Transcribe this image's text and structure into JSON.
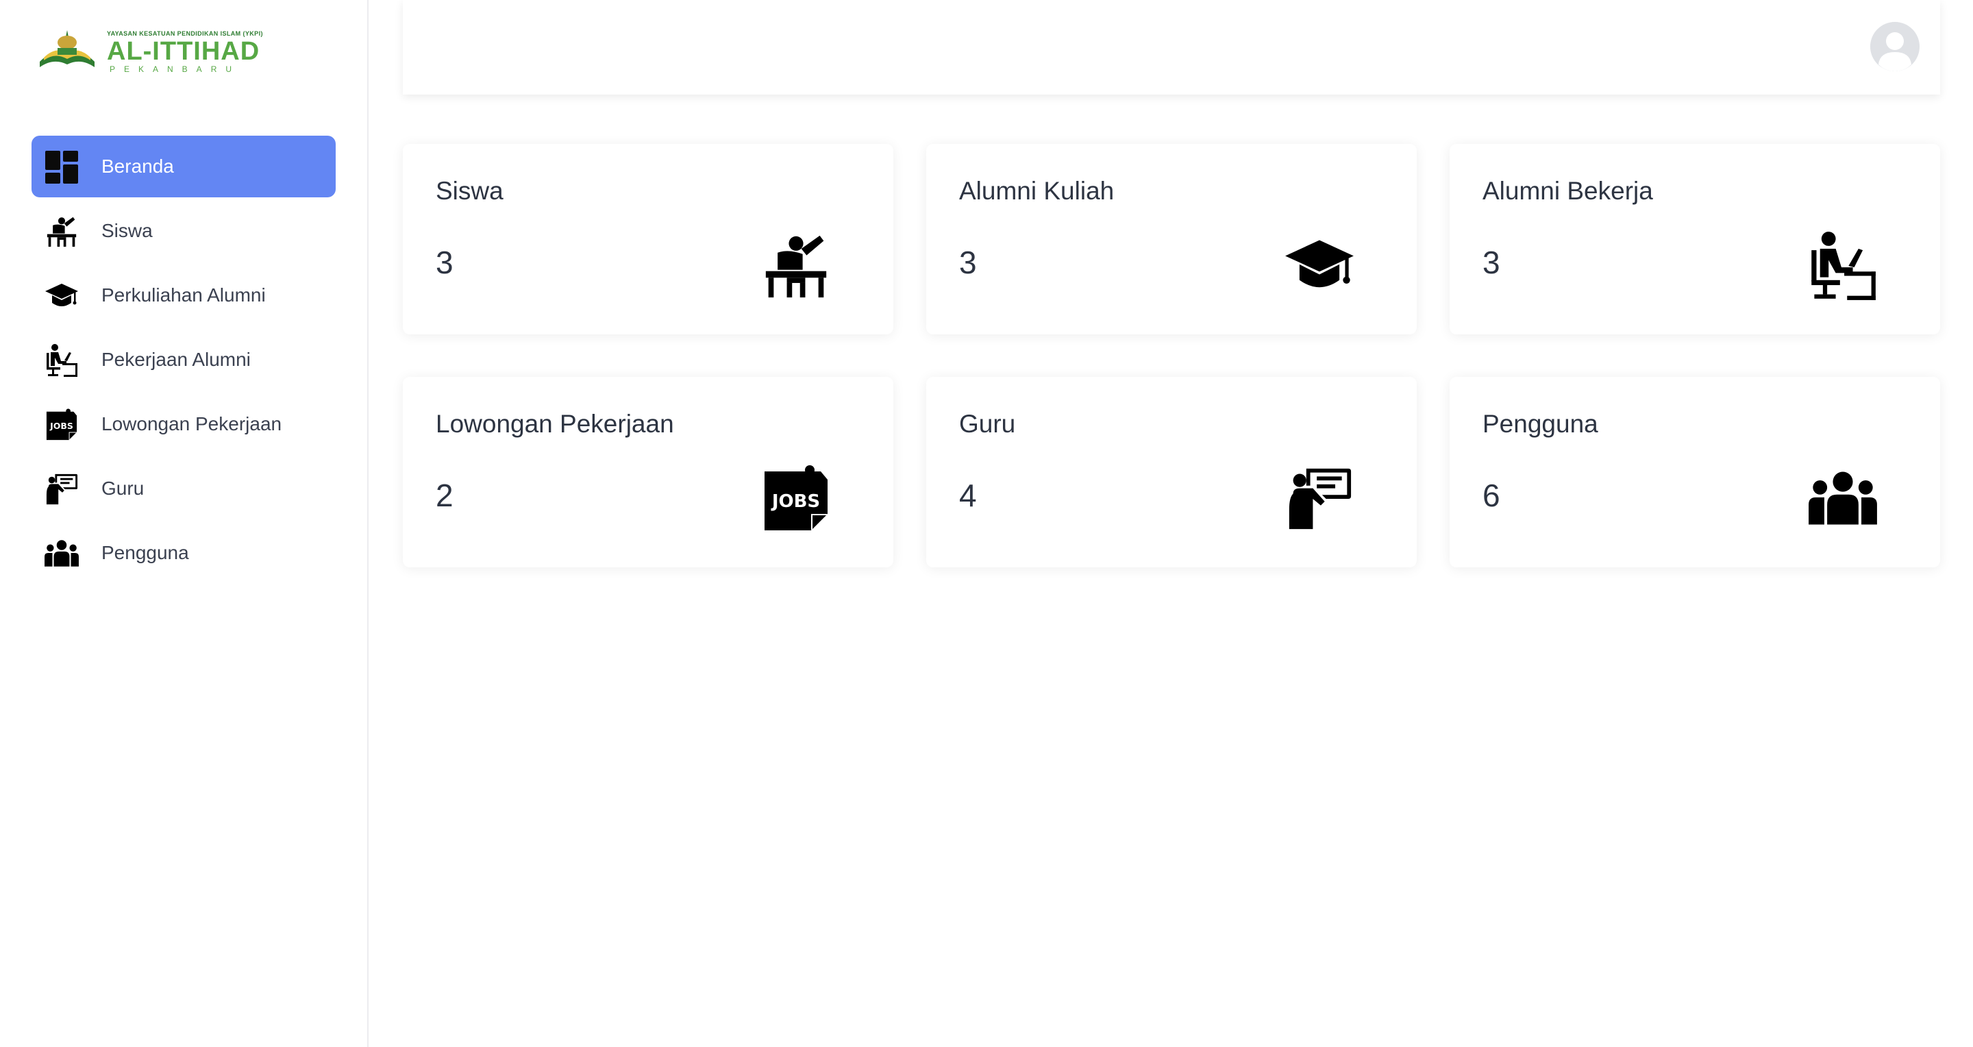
{
  "brand": {
    "foundation": "YAYASAN KESATUAN PENDIDIKAN ISLAM (YKPI)",
    "name": "AL-ITTIHAD",
    "city": "PEKANBARU",
    "accent_color": "#57a845"
  },
  "sidebar": {
    "active_color": "#6386f3",
    "items": [
      {
        "label": "Beranda",
        "icon": "dashboard-icon",
        "active": true
      },
      {
        "label": "Siswa",
        "icon": "student-desk-icon",
        "active": false
      },
      {
        "label": "Perkuliahan Alumni",
        "icon": "graduation-cap-icon",
        "active": false
      },
      {
        "label": "Pekerjaan Alumni",
        "icon": "office-worker-icon",
        "active": false
      },
      {
        "label": "Lowongan Pekerjaan",
        "icon": "jobs-icon",
        "active": false
      },
      {
        "label": "Guru",
        "icon": "teacher-icon",
        "active": false
      },
      {
        "label": "Pengguna",
        "icon": "users-group-icon",
        "active": false
      }
    ]
  },
  "header": {
    "avatar_icon": "user-avatar-icon"
  },
  "cards": [
    {
      "title": "Siswa",
      "value": "3",
      "icon": "student-desk-icon"
    },
    {
      "title": "Alumni Kuliah",
      "value": "3",
      "icon": "graduation-cap-icon"
    },
    {
      "title": "Alumni Bekerja",
      "value": "3",
      "icon": "office-worker-icon"
    },
    {
      "title": "Lowongan Pekerjaan",
      "value": "2",
      "icon": "jobs-icon"
    },
    {
      "title": "Guru",
      "value": "4",
      "icon": "teacher-icon"
    },
    {
      "title": "Pengguna",
      "value": "6",
      "icon": "users-group-icon"
    }
  ]
}
